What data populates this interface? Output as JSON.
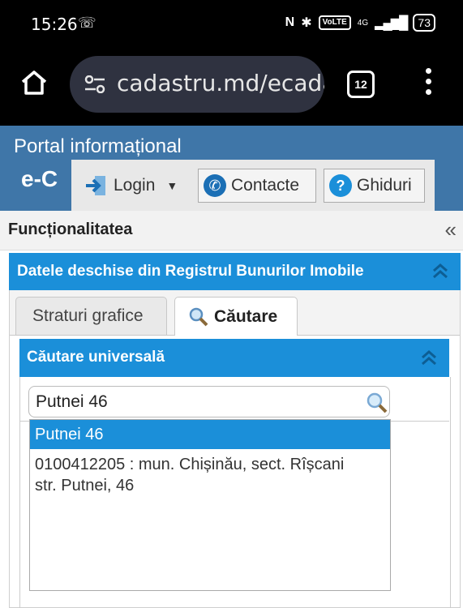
{
  "status_bar": {
    "time": "15:26",
    "signal_label": "4G",
    "volte": "VoLTE",
    "battery": "73"
  },
  "browser": {
    "url": "cadastru.md/ecada",
    "tab_count": "12"
  },
  "header": {
    "portal_title": "Portal informațional",
    "brand": "e-C"
  },
  "top_menu": {
    "login": "Login",
    "contacts": "Contacte",
    "guides": "Ghiduri"
  },
  "sidebar": {
    "title": "Funcționalitatea"
  },
  "panel": {
    "title": "Datele deschise din Registrul Bunurilor Imobile",
    "tabs": [
      {
        "label": "Straturi grafice"
      },
      {
        "label": "Căutare"
      }
    ]
  },
  "search": {
    "section_title": "Căutare universală",
    "value": "Putnei 46",
    "suggestions": [
      {
        "text": "Putnei 46"
      },
      {
        "line1": "0100412205 : mun. Chișinău, sect. Rîșcani",
        "line2": "str. Putnei, 46"
      }
    ]
  },
  "colors": {
    "header_bg": "#3f76a8",
    "panel_head": "#1b8fd9",
    "selected_item": "#1b8fd9"
  }
}
